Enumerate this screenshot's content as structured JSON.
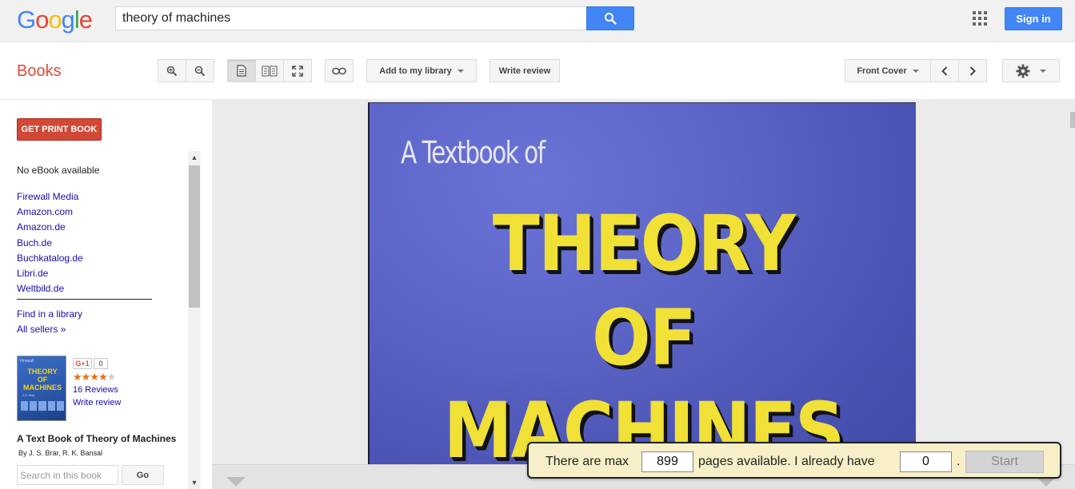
{
  "header": {
    "logo": [
      "G",
      "o",
      "o",
      "g",
      "l",
      "e"
    ],
    "logo_colors": [
      "#4285f4",
      "#ea4335",
      "#fbbc05",
      "#4285f4",
      "#34a853",
      "#ea4335"
    ],
    "search_value": "theory of machines",
    "signin_label": "Sign in"
  },
  "toolbar": {
    "section_title": "Books",
    "add_library_label": "Add to my library",
    "write_review_label": "Write review",
    "page_select_label": "Front Cover"
  },
  "sidebar": {
    "print_book_label": "GET PRINT BOOK",
    "no_ebook": "No eBook available",
    "sellers": [
      "Firewall Media",
      "Amazon.com",
      "Amazon.de",
      "Buch.de",
      "Buchkatalog.de",
      "Libri.de",
      "Weltbild.de"
    ],
    "find_library": "Find in a library",
    "all_sellers": "All sellers »",
    "gplus_label": "G+1",
    "gplus_count": "0",
    "rating": 4,
    "rating_max": 5,
    "reviews": "16 Reviews",
    "write_review": "Write review",
    "book_title": "A Text Book of Theory of Machines",
    "book_authors": "By J. S. Brar, R. K. Bansal",
    "search_placeholder": "Search in this book",
    "go_label": "Go",
    "thumb_title": "THEORY OF MACHINES"
  },
  "cover": {
    "subtitle": "A Textbook of",
    "line1": "THEORY",
    "line2": "OF",
    "line3": "MACHINES"
  },
  "download_box": {
    "text1": "There are max",
    "max_pages": "899",
    "text2": "pages available. I already have",
    "have_pages": "0",
    "period": ".",
    "start_label": "Start"
  },
  "colors": {
    "accent": "#4285f4",
    "books_red": "#dd4b39",
    "print_button": "#d14836",
    "link": "#1a0dab",
    "cover_yellow": "#f1e036"
  }
}
